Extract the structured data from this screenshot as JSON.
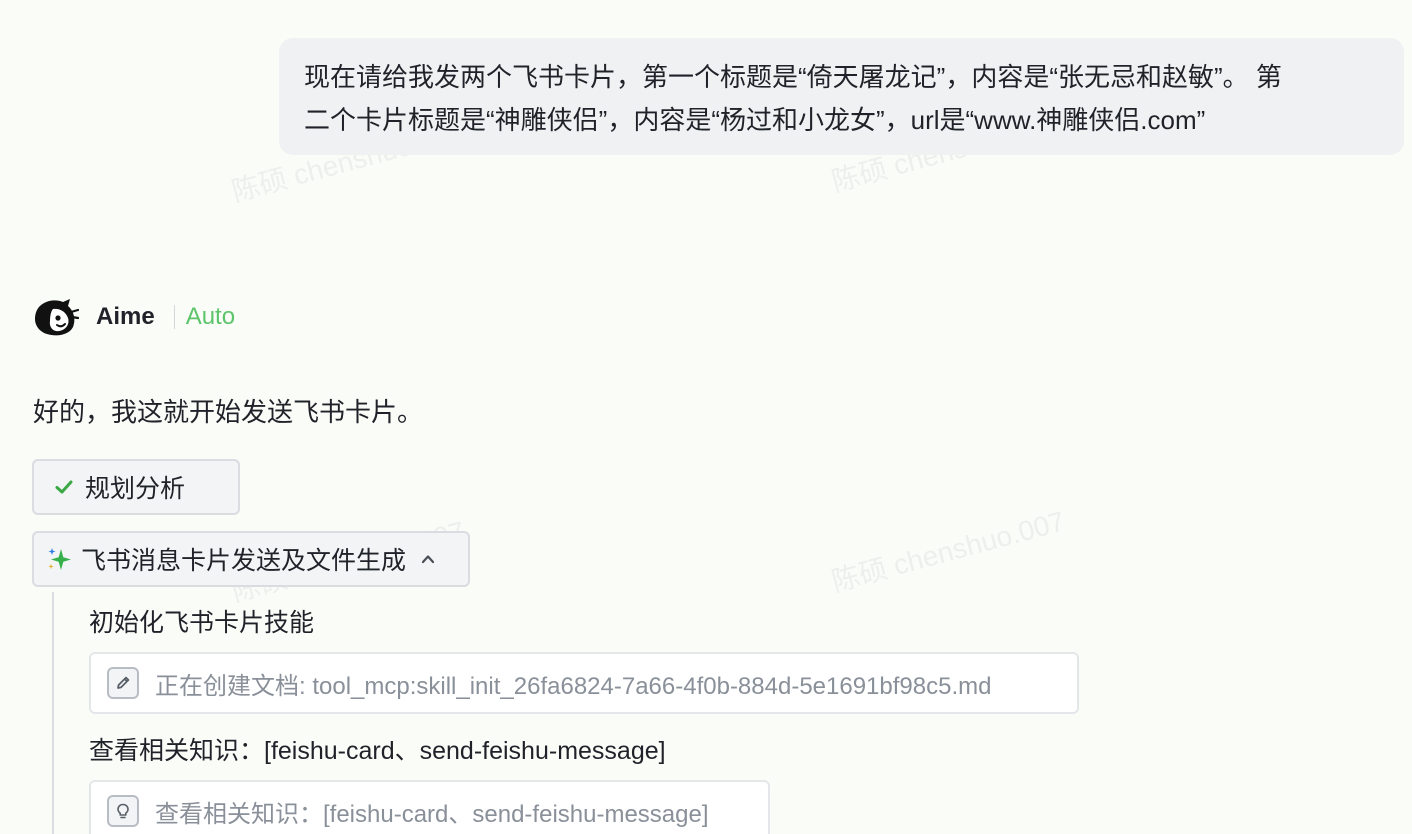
{
  "watermark": {
    "text": "陈硕 chenshuo.007"
  },
  "user_message": {
    "line1": "现在请给我发两个飞书卡片，第一个标题是“倚天屠龙记”，内容是“张无忌和赵敏”。 第",
    "line2": "二个卡片标题是“神雕侠侣”，内容是“杨过和小龙女”，url是“www.神雕侠侣.com”"
  },
  "assistant": {
    "name": "Aime",
    "mode": "Auto",
    "mode_color": "#5cc46a",
    "avatar_icon": "aime-logo-icon"
  },
  "reply": {
    "text": "好的，我这就开始发送飞书卡片。"
  },
  "steps": {
    "plan": {
      "label": "规划分析",
      "icon": "check-icon",
      "icon_color": "#3aa845"
    },
    "task": {
      "label": "飞书消息卡片发送及文件生成",
      "icon": "sparkle-icon",
      "expanded": true,
      "chevron_icon": "chevron-up-icon"
    },
    "items": [
      {
        "title": "初始化飞书卡片技能",
        "tool_icon": "pencil-icon",
        "tool_text": "正在创建文档: tool_mcp:skill_init_26fa6824-7a66-4f0b-884d-5e1691bf98c5.md"
      },
      {
        "title": "查看相关知识：[feishu-card、send-feishu-message]",
        "tool_icon": "lightbulb-icon",
        "tool_text": "查看相关知识：[feishu-card、send-feishu-message]"
      }
    ]
  }
}
